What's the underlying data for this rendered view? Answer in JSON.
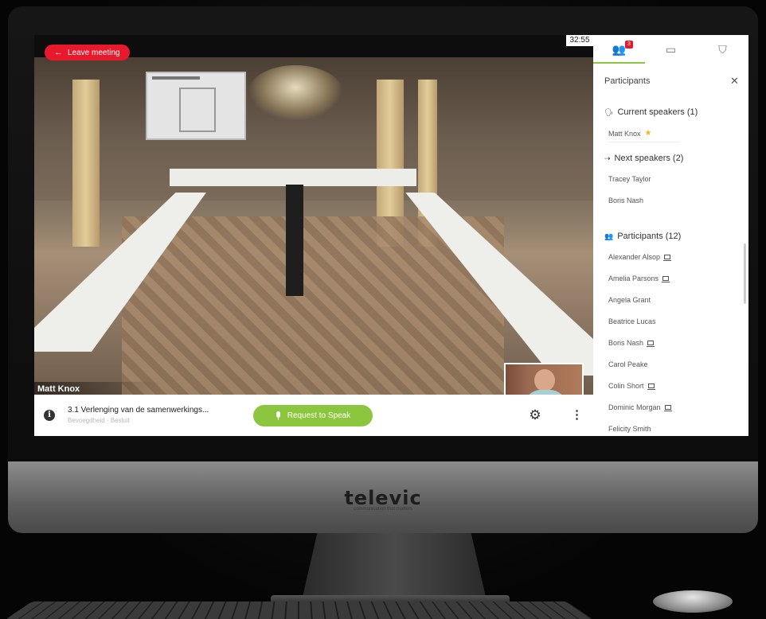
{
  "brand": {
    "name": "televic",
    "tagline": "communication that matters"
  },
  "meeting": {
    "leave_label": "Leave meeting",
    "timer": "32:55",
    "speaker_name": "Matt Knox"
  },
  "bottombar": {
    "agenda_title": "3.1 Verlenging van de samenwerkings...",
    "agenda_sub": "Bevoegdheid · Besluit",
    "request_to_speak_label": "Request to Speak"
  },
  "panel": {
    "tabs": [
      {
        "icon": "participants-icon",
        "badge": "3"
      },
      {
        "icon": "chat-icon"
      },
      {
        "icon": "vote-icon"
      }
    ],
    "title": "Participants",
    "current_speakers": {
      "heading": "Current speakers (1)",
      "items": [
        "Matt Knox"
      ]
    },
    "next_speakers": {
      "heading": "Next speakers (2)",
      "items": [
        "Tracey Taylor",
        "Boris Nash"
      ]
    },
    "participants": {
      "heading": "Participants (12)",
      "items": [
        {
          "name": "Alexander Alsop",
          "laptop": true
        },
        {
          "name": "Amelia Parsons",
          "laptop": true
        },
        {
          "name": "Angela Grant",
          "laptop": false
        },
        {
          "name": "Beatrice Lucas",
          "laptop": false
        },
        {
          "name": "Boris Nash",
          "laptop": true
        },
        {
          "name": "Carol Peake",
          "laptop": false
        },
        {
          "name": "Colin Short",
          "laptop": true
        },
        {
          "name": "Dominic Morgan",
          "laptop": true
        },
        {
          "name": "Felicity Smith",
          "laptop": false
        }
      ]
    }
  },
  "colors": {
    "accent_green": "#8cc63f",
    "leave_red": "#e8192c",
    "star": "#f3b51a"
  }
}
